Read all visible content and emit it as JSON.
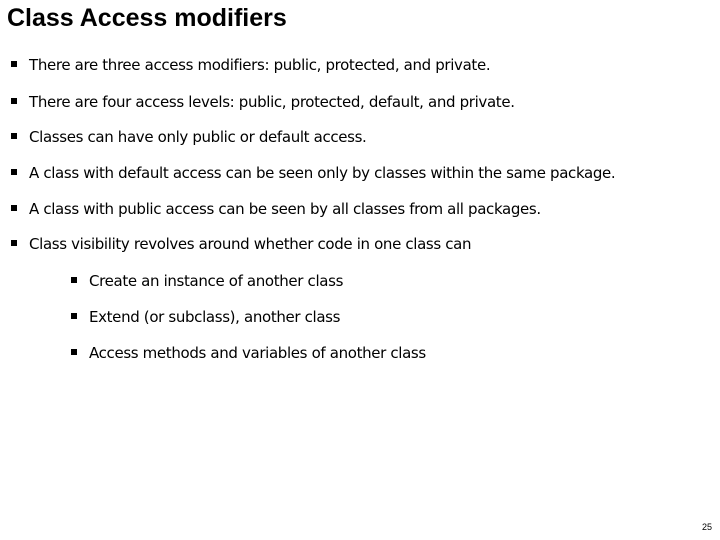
{
  "slide": {
    "title": "Class Access modifiers",
    "bullets": [
      "There are three access modifiers: public, protected, and private.",
      "There are four access levels: public, protected, default, and private.",
      "Classes can have only public or default access.",
      "A class with default access can be seen only by classes within the same package.",
      "A class with public access can be seen by all classes from all packages.",
      "Class visibility revolves around whether code in one class can"
    ],
    "sub_bullets": [
      "Create an instance of another class",
      "Extend (or subclass), another class",
      "Access methods and variables of another class"
    ],
    "page_number": "25"
  }
}
